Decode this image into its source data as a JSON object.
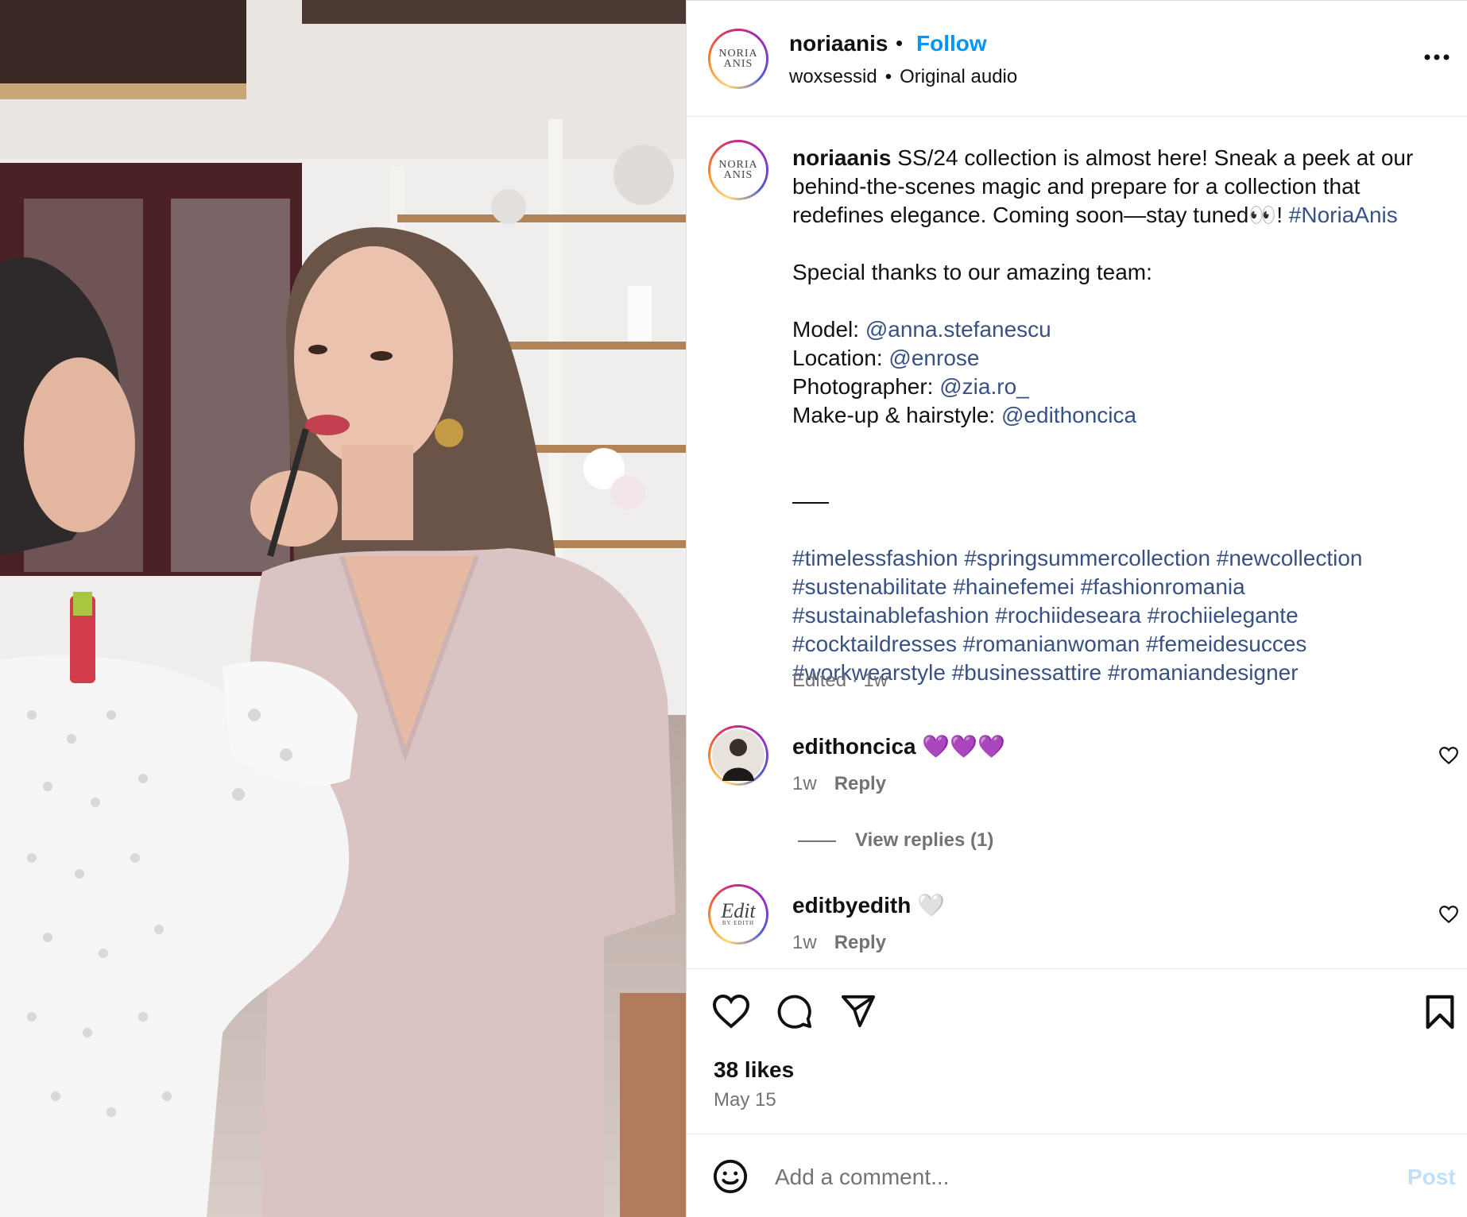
{
  "post": {
    "username": "noriaanis",
    "avatar_text": [
      "NORIA",
      "ANIS"
    ],
    "dot": "•",
    "follow_label": "Follow",
    "audio_user": "woxsessid",
    "sub_sep": "•",
    "audio_label": "Original audio",
    "more_icon": "more-horizontal-icon"
  },
  "caption": {
    "username": "noriaanis",
    "line1": "SS/24 collection is almost here! Sneak a peek at our",
    "line2": "behind-the-scenes magic and prepare for a collection that",
    "line3_text": "redefines elegance. Coming soon—stay tuned👀!",
    "line3_tag": "#NoriaAnis",
    "thanks": "Special thanks to our amazing team:",
    "credits": [
      {
        "label": "Model:",
        "handle": "@anna.stefanescu"
      },
      {
        "label": "Location:",
        "handle": "@enrose"
      },
      {
        "label": "Photographer:",
        "handle": "@zia.ro_"
      },
      {
        "label": "Make-up & hairstyle:",
        "handle": "@edithoncica"
      }
    ],
    "hashtag_lines": [
      "#timelessfashion #springsummercollection #newcollection",
      "#sustenabilitate #hainefemei #fashionromania",
      "#sustainablefashion #rochiideseara #rochiielegante",
      "#cocktaildresses #romanianwoman #femeidesucces",
      "#workwearstyle #businessattire #romaniandesigner"
    ],
    "edited": "Edited · 1w"
  },
  "comments": [
    {
      "username": "edithoncica",
      "text": "💜💜💜",
      "time": "1w",
      "reply_label": "Reply",
      "view_replies": "View replies (1)"
    },
    {
      "username": "editbyedith",
      "avatar_text": "Edit",
      "avatar_sub": "BY EDITH",
      "text": "🤍",
      "time": "1w",
      "reply_label": "Reply"
    }
  ],
  "actions": {
    "like_icon": "heart-icon",
    "comment_icon": "comment-icon",
    "share_icon": "send-icon",
    "save_icon": "bookmark-icon"
  },
  "likes": "38 likes",
  "date": "May 15",
  "comment_box": {
    "placeholder": "Add a comment...",
    "post_label": "Post",
    "emoji_icon": "emoji-icon"
  },
  "colors": {
    "follow": "#0095f6",
    "link": "#385185",
    "muted": "#737373",
    "post_disabled": "#c0dffd"
  }
}
